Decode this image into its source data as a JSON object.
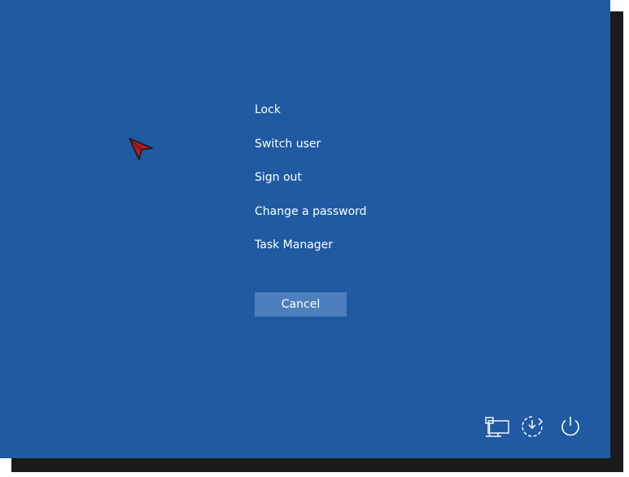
{
  "menu": {
    "items": [
      {
        "label": "Lock"
      },
      {
        "label": "Switch user"
      },
      {
        "label": "Sign out"
      },
      {
        "label": "Change a password"
      },
      {
        "label": "Task Manager"
      }
    ]
  },
  "cancel_button": {
    "label": "Cancel"
  },
  "tray_icons": [
    "network-icon",
    "ease-of-access-icon",
    "power-icon"
  ],
  "colors": {
    "background": "#1f5aa3",
    "button": "#4f7ebd",
    "text": "#ffffff",
    "cursor": "#b01c1c"
  }
}
